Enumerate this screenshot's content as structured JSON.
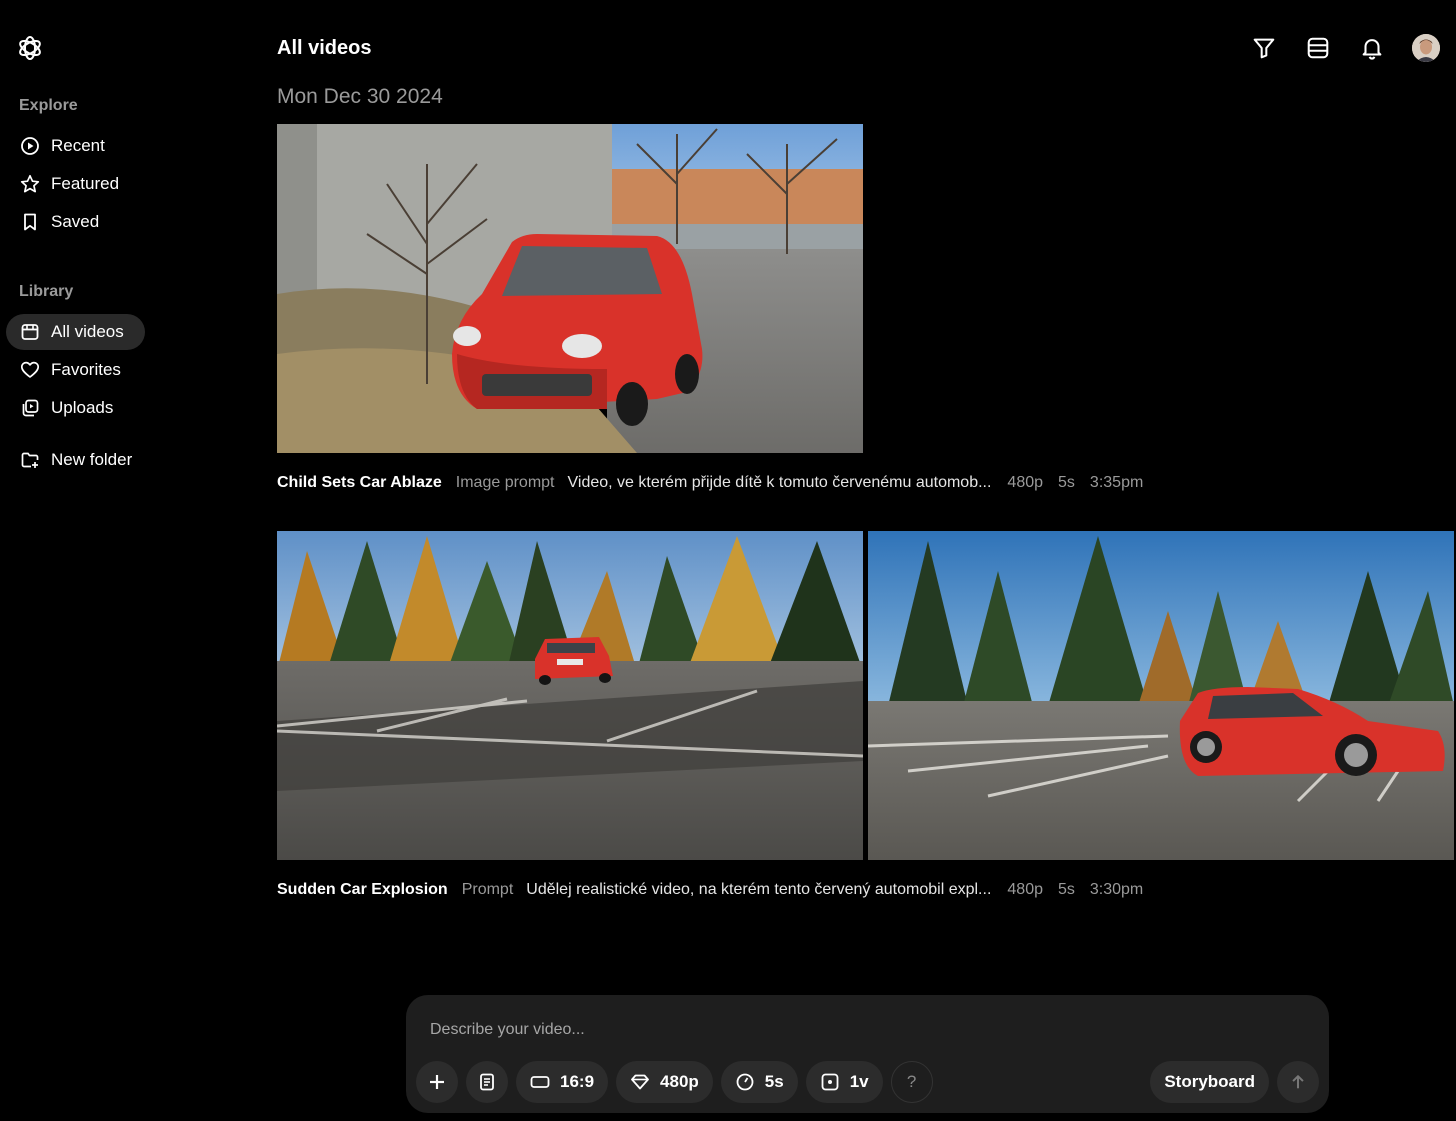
{
  "sidebar": {
    "explore_label": "Explore",
    "explore_items": [
      {
        "label": "Recent",
        "icon": "play-circle-icon"
      },
      {
        "label": "Featured",
        "icon": "star-icon"
      },
      {
        "label": "Saved",
        "icon": "bookmark-icon"
      }
    ],
    "library_label": "Library",
    "library_items": [
      {
        "label": "All videos",
        "icon": "calendar-icon",
        "active": true
      },
      {
        "label": "Favorites",
        "icon": "heart-icon"
      },
      {
        "label": "Uploads",
        "icon": "uploads-icon"
      }
    ],
    "new_folder_label": "New folder"
  },
  "header": {
    "title": "All videos",
    "icons": [
      "filter-icon",
      "grid-layout-icon",
      "bell-icon",
      "avatar"
    ]
  },
  "date_group": "Mon Dec 30 2024",
  "videos": [
    {
      "title": "Child Sets Car Ablaze",
      "kind": "Image prompt",
      "prompt": "Video, ve kterém přijde dítě k tomuto červenému automob...",
      "resolution": "480p",
      "duration": "5s",
      "time": "3:35pm"
    },
    {
      "title": "Sudden Car Explosion",
      "kind": "Prompt",
      "prompt": "Udělej realistické video, na kterém tento červený automobil expl...",
      "resolution": "480p",
      "duration": "5s",
      "time": "3:30pm"
    }
  ],
  "composer": {
    "placeholder": "Describe your video...",
    "aspect": "16:9",
    "resolution": "480p",
    "duration": "5s",
    "variations": "1v",
    "help": "?",
    "storyboard": "Storyboard"
  },
  "colors": {
    "background": "#000000",
    "surface": "#1e1e1e",
    "pill": "#2c2c2c",
    "muted_text": "#9a9a9a",
    "car_red": "#d9322a"
  }
}
